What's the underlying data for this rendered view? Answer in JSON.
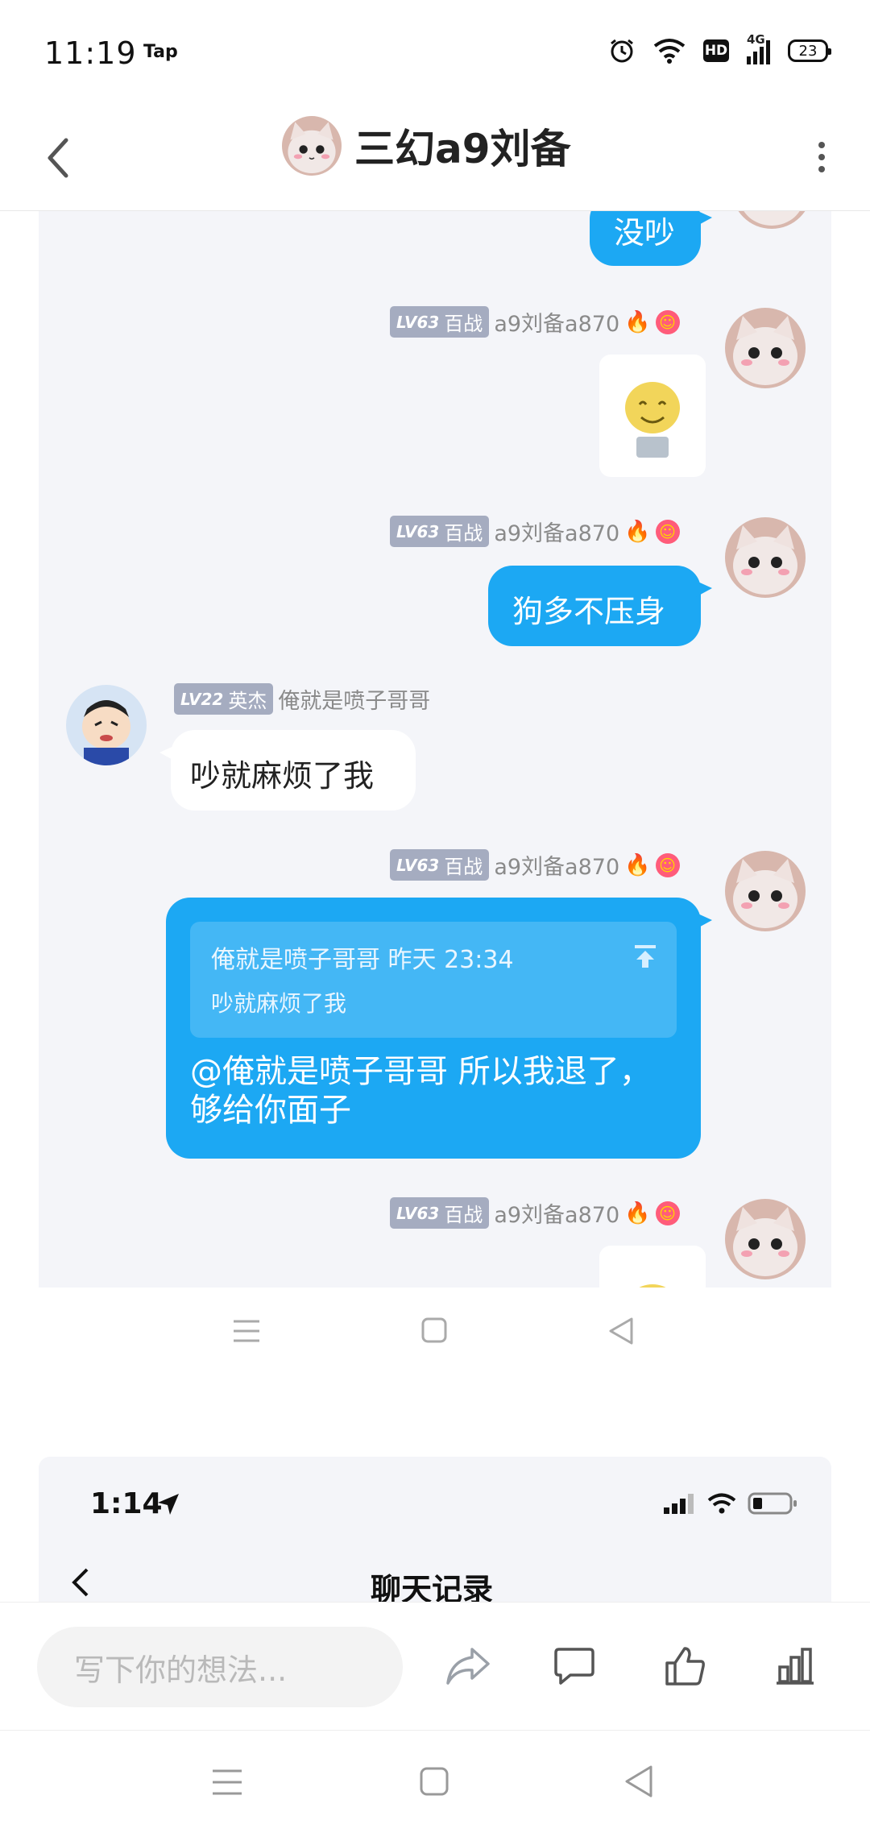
{
  "status_bar": {
    "time": "11:19",
    "app_label": "Tap",
    "network": "4G",
    "hd": "HD",
    "battery": "23"
  },
  "header": {
    "title": "三幻a9刘备"
  },
  "chat": {
    "top_partial_bubble": "没吵",
    "self_user": {
      "level": "LV63",
      "title": "百战",
      "name": "a9刘备a870"
    },
    "other_user": {
      "level": "LV22",
      "title": "英杰",
      "name": "俺就是喷子哥哥"
    },
    "msg_text_1": "狗多不压身",
    "msg_other": "吵就麻烦了我",
    "quote_header": "俺就是喷子哥哥 昨天 23:34",
    "quote_text": "吵就麻烦了我",
    "reply_text": "@俺就是喷子哥哥 所以我退了，够给你面子"
  },
  "screenshot2": {
    "time": "1:14",
    "title": "聊天记录"
  },
  "action_bar": {
    "input_placeholder": "写下你的想法..."
  },
  "icons": [
    "back-icon",
    "more-icon",
    "alarm-icon",
    "wifi-icon",
    "signal-icon",
    "fire-icon",
    "share-icon",
    "comment-icon",
    "like-icon",
    "stats-icon",
    "menu-icon",
    "home-icon",
    "triangle-back-icon"
  ],
  "colors": {
    "accent": "#1ca8f3",
    "chat_bg": "#f4f5f9",
    "level_badge": "#a5acc0"
  }
}
